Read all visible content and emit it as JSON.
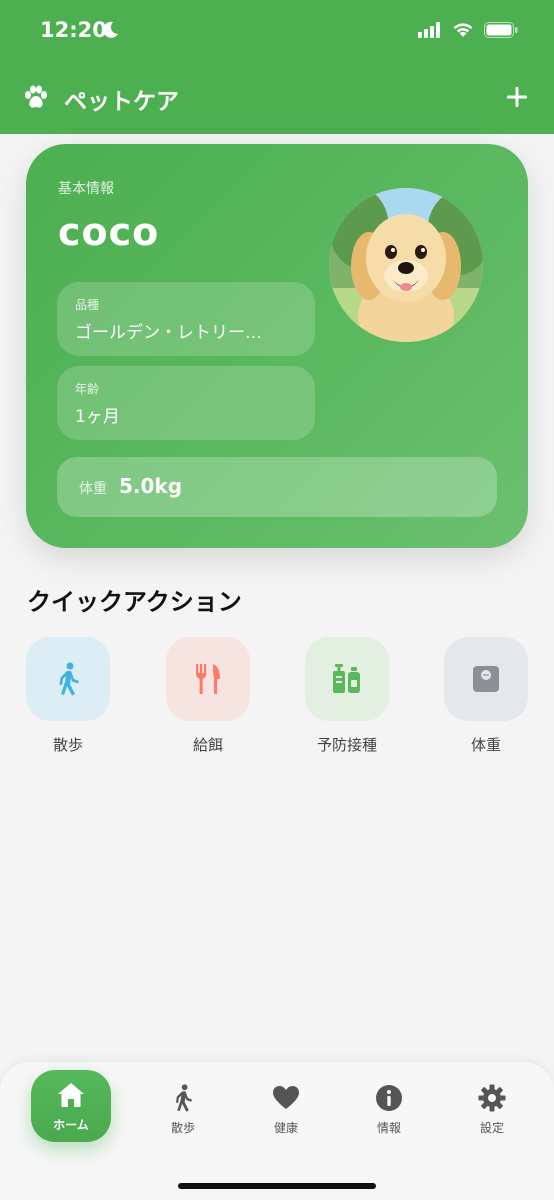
{
  "status_bar": {
    "time": "12:20"
  },
  "app_bar": {
    "title": "ペットケア",
    "icon": "paw-icon",
    "action_icon": "plus-icon"
  },
  "pet_card": {
    "heading": "基本情報",
    "name": "coco",
    "breed_label": "品種",
    "breed_value": "ゴールデン・レトリー…",
    "age_label": "年齢",
    "age_value": "1ヶ月",
    "weight_label": "体重",
    "weight_value": "5.0kg"
  },
  "quick_actions": {
    "title": "クイックアクション",
    "items": [
      {
        "label": "散歩",
        "icon": "walk-icon",
        "color": "#41b3e0"
      },
      {
        "label": "給餌",
        "icon": "fork-knife-icon",
        "color": "#ff7a66"
      },
      {
        "label": "予防接種",
        "icon": "vaccine-icon",
        "color": "#5cb85c"
      },
      {
        "label": "体重",
        "icon": "scale-icon",
        "color": "#8a9096"
      }
    ]
  },
  "bottom_nav": {
    "items": [
      {
        "label": "ホーム",
        "icon": "home-icon",
        "active": true
      },
      {
        "label": "散歩",
        "icon": "walk-icon",
        "active": false
      },
      {
        "label": "健康",
        "icon": "heart-icon",
        "active": false
      },
      {
        "label": "情報",
        "icon": "info-icon",
        "active": false
      },
      {
        "label": "設定",
        "icon": "gear-icon",
        "active": false
      }
    ]
  },
  "colors": {
    "primary": "#4caf50",
    "background": "#f4f4f4"
  }
}
